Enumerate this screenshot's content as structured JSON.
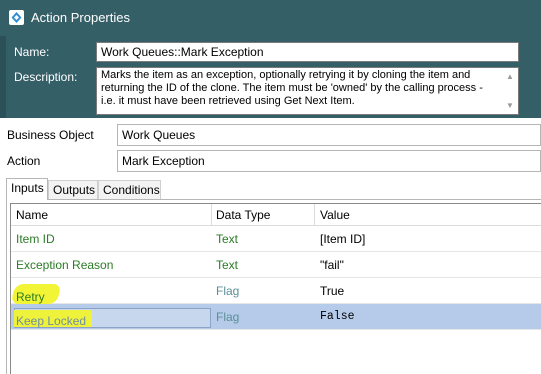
{
  "window": {
    "title": "Action Properties",
    "icon": "blue-prism-diamond-icon",
    "colors": {
      "header_bg": "#355f67",
      "selected_row": "#b6cbe9",
      "green_text": "#2b7b26",
      "highlight": "#f1f535"
    }
  },
  "header": {
    "name_label": "Name:",
    "name_value": "Work Queues::Mark Exception",
    "description_label": "Description:",
    "description_value": "Marks the item as an exception, optionally retrying it by cloning the item and returning the ID of the clone. The item must be 'owned' by the calling process - i.e. it must have been retrieved using Get Next Item."
  },
  "fields": {
    "business_object_label": "Business Object",
    "business_object_value": "Work Queues",
    "action_label": "Action",
    "action_value": "Mark Exception"
  },
  "tabs": [
    {
      "label": "Inputs"
    },
    {
      "label": "Outputs"
    },
    {
      "label": "Conditions"
    }
  ],
  "grid": {
    "columns": [
      "Name",
      "Data Type",
      "Value"
    ],
    "rows": [
      {
        "name": "Item ID",
        "type": "Text",
        "value": "[Item ID]"
      },
      {
        "name": "Exception Reason",
        "type": "Text",
        "value": "\"fail\""
      },
      {
        "name": "Retry",
        "type": "Flag",
        "value": "True"
      },
      {
        "name": "Keep Locked",
        "type": "Flag",
        "value": "False"
      }
    ]
  }
}
